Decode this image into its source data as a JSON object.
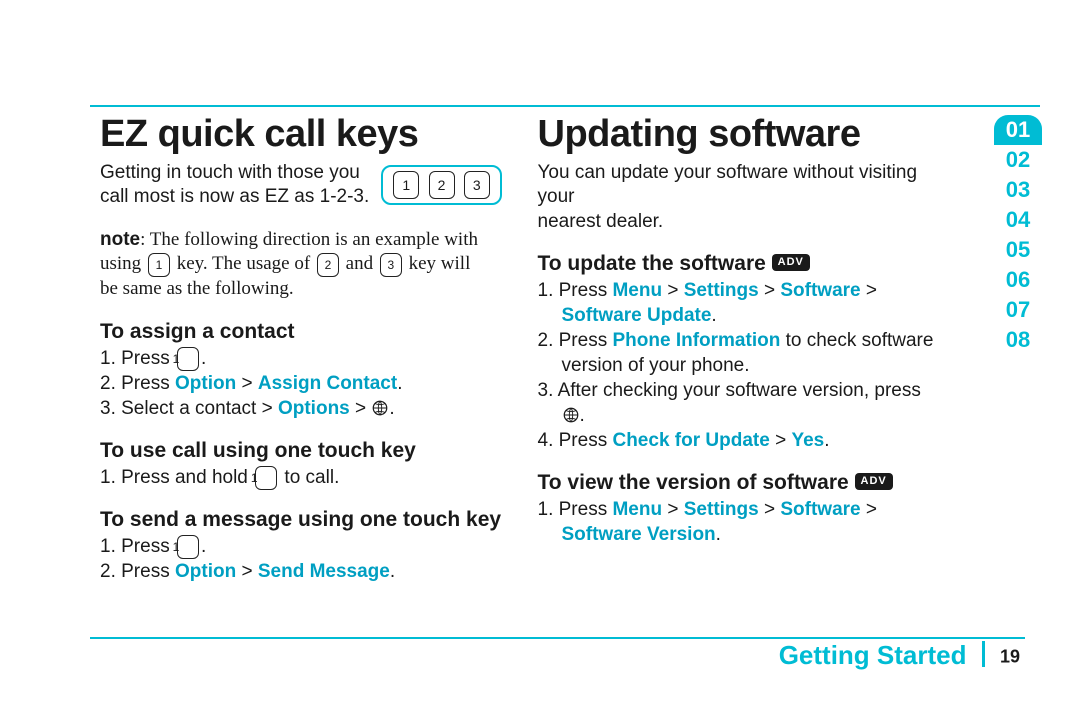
{
  "sidenav": {
    "items": [
      "01",
      "02",
      "03",
      "04",
      "05",
      "06",
      "07",
      "08"
    ],
    "active_index": 0
  },
  "footer": {
    "section": "Getting Started",
    "page": "19"
  },
  "left": {
    "heading": "EZ quick call keys",
    "intro_l1": "Getting in touch with those you",
    "intro_l2": "call most is now as EZ as 1-2-3.",
    "keys": {
      "k1": "1",
      "k2": "2",
      "k3": "3"
    },
    "note_label": "note",
    "note_l1": ": The following direction is an example with",
    "note_l2": "using ",
    "note_l2b": " key. The usage of ",
    "note_l2c": " and ",
    "note_l2d": " key will",
    "note_l3": "be same as the following.",
    "sec1": {
      "title": "To assign a contact",
      "s1a": "1. Press ",
      "s1b": ".",
      "s2a": "2. Press ",
      "s2b": "Option",
      "s2c": " > ",
      "s2d": "Assign Contact",
      "s2e": ".",
      "s3a": "3. Select a contact > ",
      "s3b": "Options",
      "s3c": " > ",
      "s3d": "."
    },
    "sec2": {
      "title": "To use call using one touch key",
      "s1a": "1. Press and hold ",
      "s1b": " to call."
    },
    "sec3": {
      "title": "To send a message using one touch key",
      "s1a": "1. Press ",
      "s1b": ".",
      "s2a": "2. Press ",
      "s2b": "Option",
      "s2c": " > ",
      "s2d": "Send Message",
      "s2e": "."
    }
  },
  "right": {
    "heading": "Updating software",
    "intro_l1": "You can update your software without visiting your",
    "intro_l2": "nearest dealer.",
    "adv": "ADV",
    "sec1": {
      "title": "To update the software ",
      "s1a": "1. Press ",
      "s1b": "Menu",
      "s1c": " > ",
      "s1d": "Settings",
      "s1e": " > ",
      "s1f": "Software",
      "s1g": " > ",
      "s1h": "Software Update",
      "s1i": ".",
      "s2a": "2. Press ",
      "s2b": "Phone Information",
      "s2c": " to check software",
      "s2d": "version of your phone.",
      "s3a": "3. After checking your software version, press",
      "s3b": ".",
      "s4a": "4. Press ",
      "s4b": "Check for Update",
      "s4c": " > ",
      "s4d": "Yes",
      "s4e": "."
    },
    "sec2": {
      "title": "To view the version of software ",
      "s1a": "1. Press ",
      "s1b": "Menu",
      "s1c": " > ",
      "s1d": "Settings",
      "s1e": " > ",
      "s1f": "Software",
      "s1g": " > ",
      "s1h": "Software Version",
      "s1i": "."
    }
  }
}
